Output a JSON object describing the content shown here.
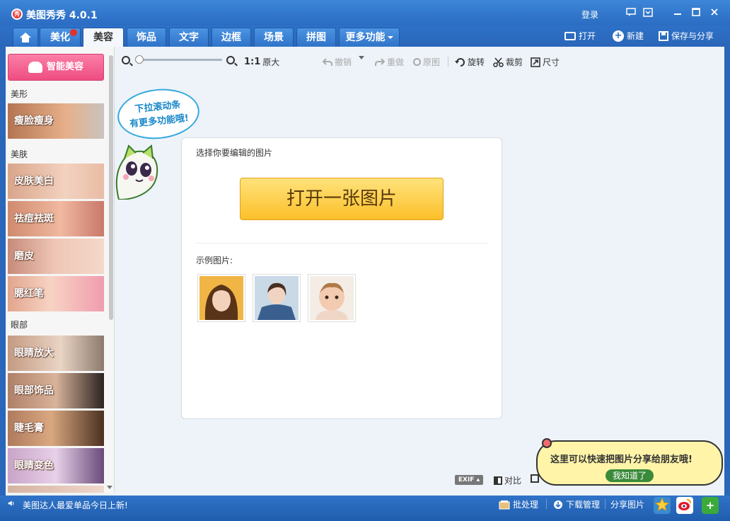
{
  "window": {
    "title": "美图秀秀 4.0.1",
    "logo_glyph": "秀",
    "login": "登录",
    "controls": [
      "feedback-icon",
      "skin-icon",
      "minimize-icon",
      "maximize-icon",
      "close-icon"
    ]
  },
  "nav": {
    "tabs": [
      {
        "label": "美化",
        "badge": true
      },
      {
        "label": "美容",
        "active": true
      },
      {
        "label": "饰品"
      },
      {
        "label": "文字"
      },
      {
        "label": "边框"
      },
      {
        "label": "场景"
      },
      {
        "label": "拼图"
      },
      {
        "label": "更多功能"
      }
    ]
  },
  "top_actions": {
    "open": "打开",
    "new": "新建",
    "save_share": "保存与分享"
  },
  "toolbar": {
    "ratio": "1:1",
    "original_size": "原大",
    "undo": "撤销",
    "redo": "重做",
    "original": "原图",
    "rotate": "旋转",
    "crop": "裁剪",
    "size": "尺寸",
    "zoom_level": 0
  },
  "sidebar": {
    "smart_beauty": "智能美容",
    "sections": [
      {
        "label": "美形",
        "items": [
          "瘦脸瘦身"
        ]
      },
      {
        "label": "美肤",
        "items": [
          "皮肤美白",
          "祛痘祛斑",
          "磨皮",
          "腮红笔"
        ]
      },
      {
        "label": "眼部",
        "items": [
          "眼睛放大",
          "眼部饰品",
          "睫毛膏",
          "眼睛变色"
        ]
      }
    ]
  },
  "mascot": {
    "bubble_line1": "下拉滚动条",
    "bubble_line2": "有更多功能哦!"
  },
  "panel": {
    "select_label": "选择你要编辑的图片",
    "open_button": "打开一张图片",
    "sample_label": "示例图片:"
  },
  "canvas_footer": {
    "exif": "EXIF",
    "compare": "对比"
  },
  "share_tip": {
    "text": "这里可以快速把图片分享给朋友哦!",
    "button": "我知道了"
  },
  "statusbar": {
    "news": "美图达人最爱单品今日上新!",
    "batch": "批处理",
    "download": "下载管理",
    "share": "分享图片"
  },
  "colors": {
    "title_blue": "#2a6cc2",
    "smart_pink": "#ee4d82",
    "open_yellow": "#fbc02a",
    "tip_yellow": "#fff4a8"
  }
}
